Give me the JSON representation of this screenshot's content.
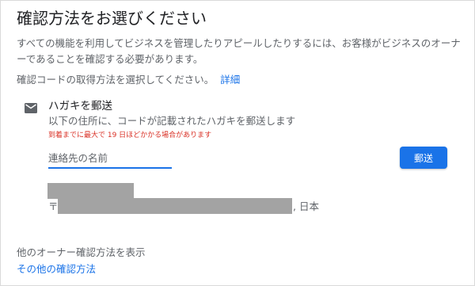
{
  "dialog": {
    "title": "確認方法をお選びください",
    "description": "すべての機能を利用してビジネスを管理したりアピールしたりするには、お客様がビジネスのオーナーであることを確認する必要があります。",
    "select_prompt": "確認コードの取得方法を選択してください。",
    "details_link": "詳細"
  },
  "postcard_option": {
    "icon": "mail-icon",
    "title": "ハガキを郵送",
    "subtitle": "以下の住所に、コードが記載されたハガキを郵送します",
    "warning": "到着までに最大で 19 日ほどかかる場合があります",
    "name_field": {
      "placeholder": "連絡先の名前",
      "value": ""
    },
    "send_button": "郵送",
    "address": {
      "prefix": "〒",
      "country": ", 日本"
    }
  },
  "other_methods": {
    "title": "他のオーナー確認方法を表示",
    "link": "その他の確認方法"
  },
  "colors": {
    "accent": "#1a73e8",
    "warning": "#d93025",
    "redaction": "#a3a3a3"
  }
}
